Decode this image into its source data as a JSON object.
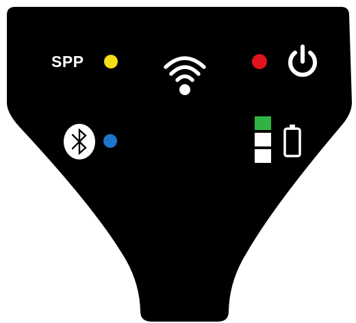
{
  "panel": {
    "background_color": "#000000",
    "spp_indicator": {
      "label": "SPP",
      "led_color": "#f4de16"
    },
    "wifi_indicator": {
      "icon": "wifi-icon",
      "color": "#ffffff"
    },
    "power_indicator": {
      "led_color": "#e0141b",
      "icon": "power-icon"
    },
    "bluetooth_indicator": {
      "icon": "bluetooth-icon",
      "badge_color": "#ffffff",
      "led_color": "#1b76c9"
    },
    "battery_indicator": {
      "icon": "battery-icon",
      "level_segments": 3,
      "segment_colors": [
        "#2fb344",
        "#ffffff",
        "#ffffff"
      ]
    }
  }
}
